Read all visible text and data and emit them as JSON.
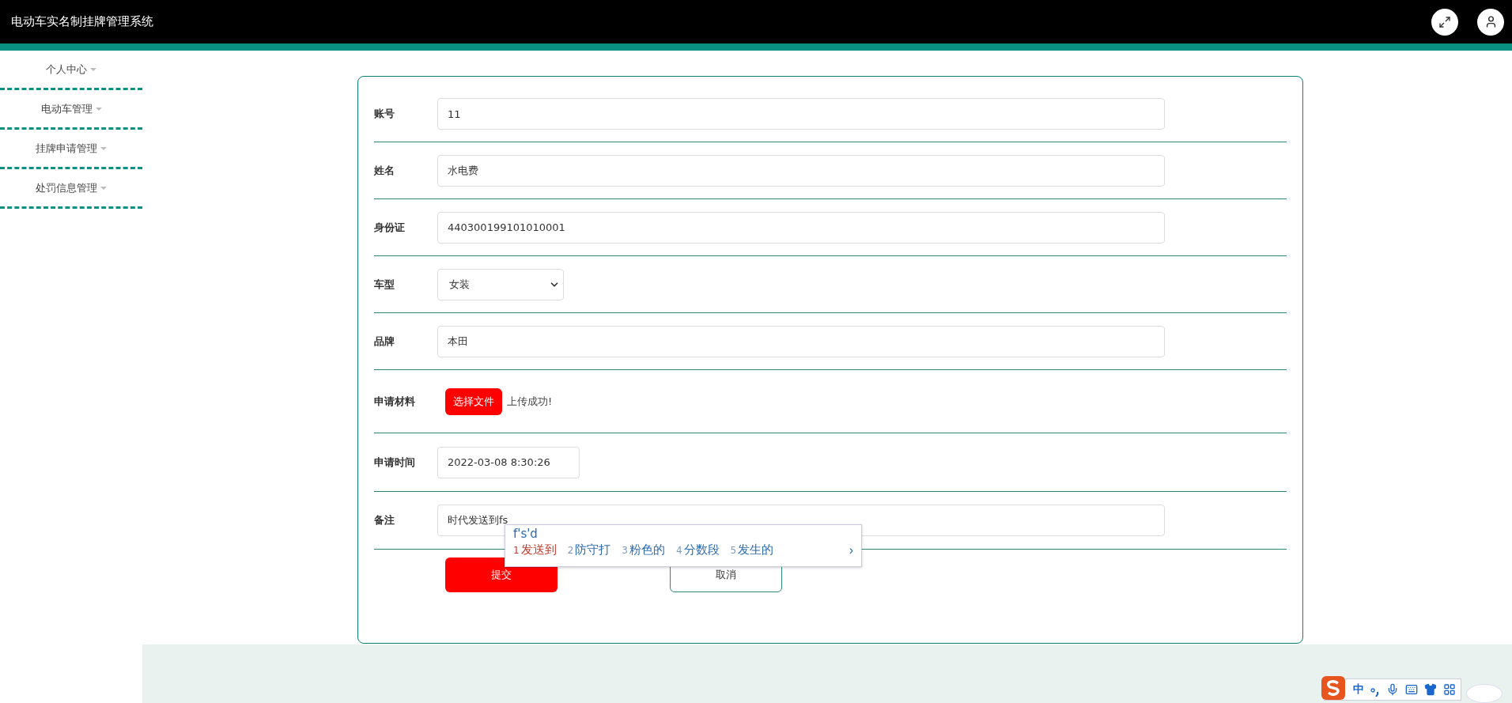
{
  "header": {
    "title": "电动车实名制挂牌管理系统"
  },
  "sidebar": {
    "items": [
      {
        "label": "个人中心"
      },
      {
        "label": "电动车管理"
      },
      {
        "label": "挂牌申请管理"
      },
      {
        "label": "处罚信息管理"
      }
    ]
  },
  "form": {
    "fields": [
      {
        "kind": "text",
        "label": "账号",
        "value": "11"
      },
      {
        "kind": "text",
        "label": "姓名",
        "value": "水电费"
      },
      {
        "kind": "text",
        "label": "身份证",
        "value": "440300199101010001"
      },
      {
        "kind": "select",
        "label": "车型",
        "value": "女装"
      },
      {
        "kind": "text",
        "label": "品牌",
        "value": "本田"
      },
      {
        "kind": "file",
        "label": "申请材料",
        "button": "选择文件",
        "status": "上传成功!"
      },
      {
        "kind": "short",
        "label": "申请时间",
        "value": "2022-03-08 8:30:26"
      },
      {
        "kind": "text",
        "label": "备注",
        "value": "时代发送到fs"
      }
    ],
    "submit": "提交",
    "cancel": "取消"
  },
  "ime": {
    "composition": "f's'd",
    "candidates": [
      {
        "number": "1",
        "text": "发送到",
        "selected": true
      },
      {
        "number": "2",
        "text": "防守打",
        "selected": false
      },
      {
        "number": "3",
        "text": "粉色的",
        "selected": false
      },
      {
        "number": "4",
        "text": "分数段",
        "selected": false
      },
      {
        "number": "5",
        "text": "发生的",
        "selected": false
      }
    ],
    "next": "›"
  },
  "ime_toolbar": {
    "mode": "中"
  }
}
